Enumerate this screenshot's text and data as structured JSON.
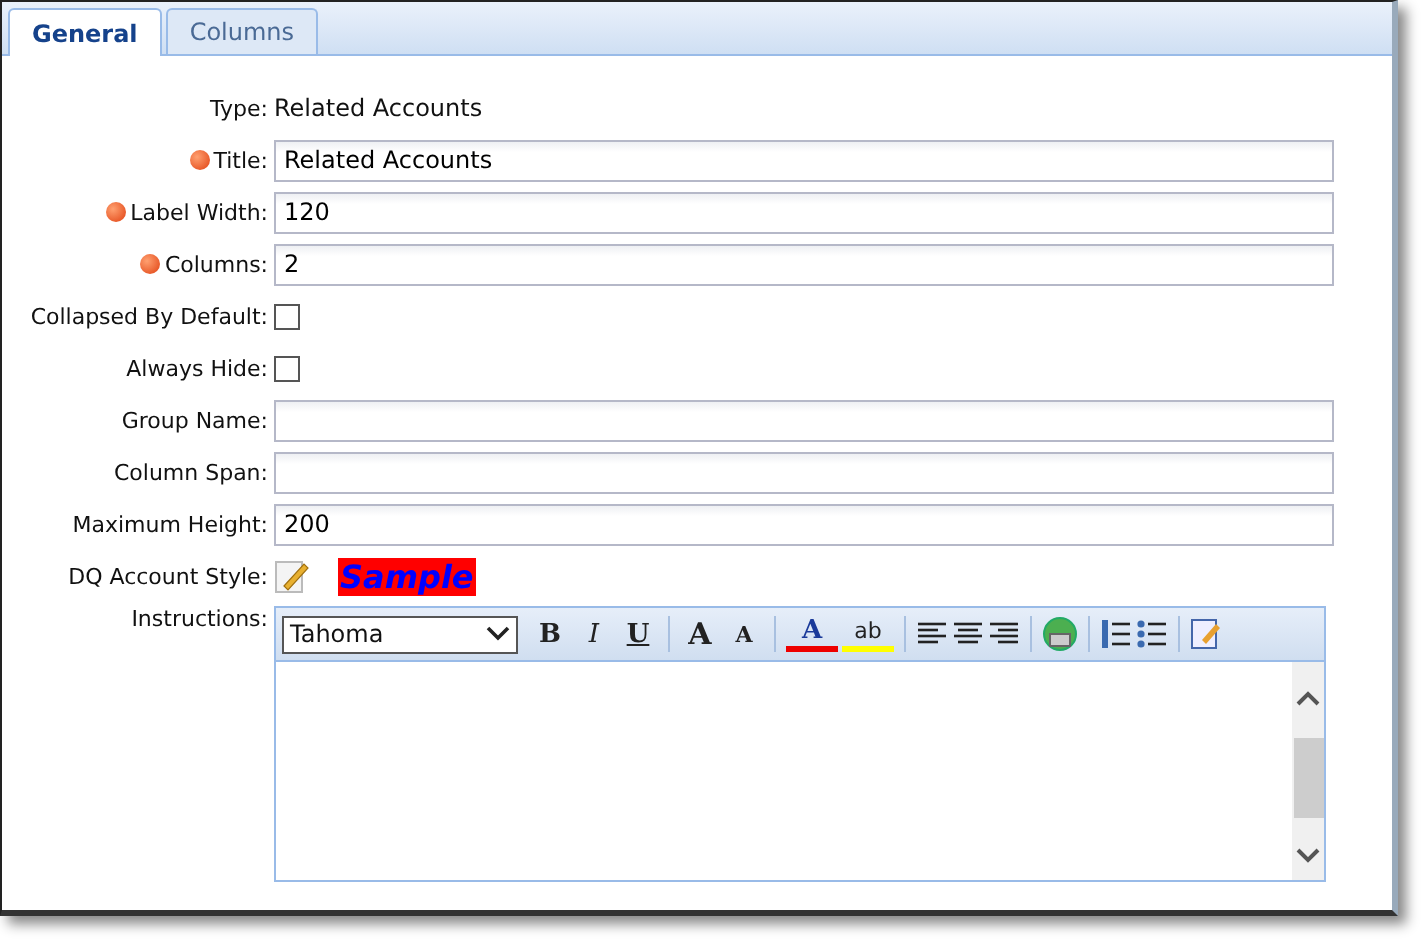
{
  "tabs": [
    {
      "label": "General",
      "selected": true
    },
    {
      "label": "Columns",
      "selected": false
    }
  ],
  "fields": [
    {
      "kind": "text",
      "label": "Type:",
      "required": false,
      "value": "Related Accounts"
    },
    {
      "kind": "input",
      "label": "Title:",
      "required": true,
      "value": "Related Accounts"
    },
    {
      "kind": "input",
      "label": "Label Width:",
      "required": true,
      "value": "120"
    },
    {
      "kind": "input",
      "label": "Columns:",
      "required": true,
      "value": "2"
    },
    {
      "kind": "checkbox",
      "label": "Collapsed By Default:",
      "required": false,
      "checked": false
    },
    {
      "kind": "checkbox",
      "label": "Always Hide:",
      "required": false,
      "checked": false
    },
    {
      "kind": "input",
      "label": "Group Name:",
      "required": false
    },
    {
      "kind": "input",
      "label": "Column Span:",
      "required": false
    },
    {
      "kind": "input",
      "label": "Maximum Height:",
      "required": false,
      "value": "200"
    },
    {
      "kind": "style",
      "label": "DQ Account Style:",
      "required": false,
      "sample": "Sample"
    },
    {
      "kind": "editor",
      "label": "Instructions:",
      "required": false,
      "font": "Tahoma"
    }
  ],
  "toolbar": [
    {
      "kind": "bold",
      "label": "B"
    },
    {
      "kind": "italic",
      "label": "I"
    },
    {
      "kind": "underline",
      "label": "U"
    },
    {
      "kind": "sep"
    },
    {
      "kind": "grow",
      "label": "A"
    },
    {
      "kind": "shrink",
      "label": "A"
    },
    {
      "kind": "sep"
    },
    {
      "kind": "fontcolor",
      "label": "A"
    },
    {
      "kind": "highlight",
      "label": "ab"
    },
    {
      "kind": "sep"
    },
    {
      "kind": "left"
    },
    {
      "kind": "center"
    },
    {
      "kind": "right"
    },
    {
      "kind": "sep"
    },
    {
      "kind": "link"
    },
    {
      "kind": "sep"
    },
    {
      "kind": "ol"
    },
    {
      "kind": "ul"
    },
    {
      "kind": "sep"
    },
    {
      "kind": "source"
    }
  ]
}
